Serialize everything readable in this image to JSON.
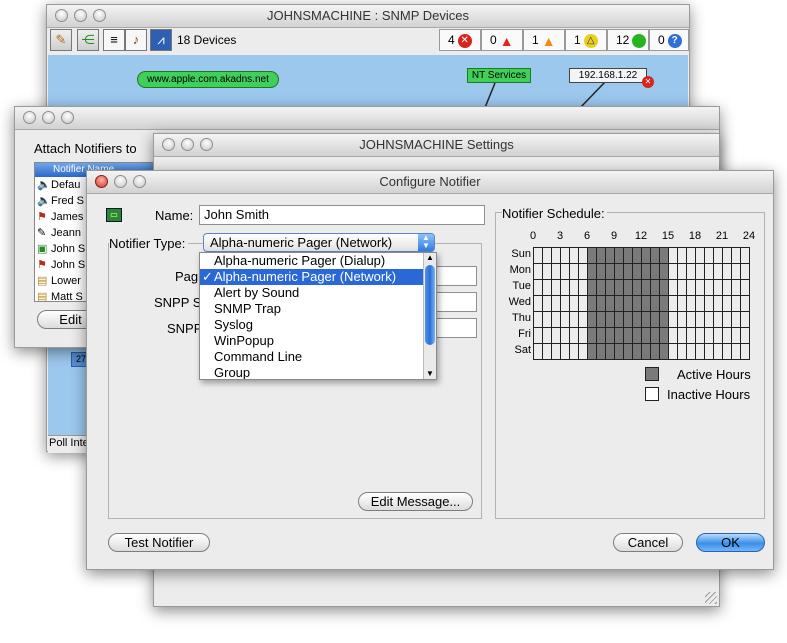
{
  "devices_window": {
    "title": "JOHNSMACHINE : SNMP Devices",
    "device_count": "18 Devices",
    "status_counts": [
      {
        "count": "4",
        "icon": "error-circle-icon",
        "color": "#d9261c"
      },
      {
        "count": "0",
        "icon": "warning-triangle-icon",
        "color": "#e2241b"
      },
      {
        "count": "1",
        "icon": "caution-triangle-icon",
        "color": "#f08a12"
      },
      {
        "count": "1",
        "icon": "notice-triangle-icon",
        "color": "#e8d020"
      },
      {
        "count": "12",
        "icon": "ok-circle-icon",
        "color": "#27b51f"
      },
      {
        "count": "0",
        "icon": "unknown-question-icon",
        "color": "#2f6fd8"
      }
    ],
    "map_nodes": {
      "apple": "www.apple.com.akadns.net",
      "nt_services": "NT Services",
      "ip": "192.168.1.22"
    },
    "poll_interval_label": "Poll Inte",
    "map_badge": "27"
  },
  "attach_window": {
    "title": "Attach Notifiers to",
    "header": "Notifier Name",
    "items": [
      "Defau",
      "Fred S",
      "James",
      "Jeann",
      "John S",
      "John S",
      "Lower",
      "Matt S"
    ],
    "edit_button": "Edit N"
  },
  "settings_window": {
    "title": "JOHNSMACHINE Settings"
  },
  "configure_dialog": {
    "title": "Configure Notifier",
    "name_label": "Name:",
    "name_value": "John Smith",
    "type_label": "Notifier Type:",
    "type_value": "Alpha-numeric Pager (Network)",
    "partial_labels": [
      "Pag",
      "SNPP Se",
      "SNPP"
    ],
    "dropdown_options": [
      "Alpha-numeric Pager (Dialup)",
      "Alpha-numeric Pager (Network)",
      "Alert by Sound",
      "SNMP Trap",
      "Syslog",
      "WinPopup",
      "Command Line",
      "Group"
    ],
    "selected_option_index": 1,
    "edit_message_button": "Edit Message...",
    "test_button": "Test Notifier",
    "cancel_button": "Cancel",
    "ok_button": "OK",
    "schedule": {
      "title": "Notifier Schedule:",
      "hour_labels": [
        "0",
        "3",
        "6",
        "9",
        "12",
        "15",
        "18",
        "21",
        "24"
      ],
      "days": [
        "Sun",
        "Mon",
        "Tue",
        "Wed",
        "Thu",
        "Fri",
        "Sat"
      ],
      "active_start_hour": 6,
      "active_end_hour": 15,
      "legend_active": "Active Hours",
      "legend_inactive": "Inactive Hours"
    }
  }
}
